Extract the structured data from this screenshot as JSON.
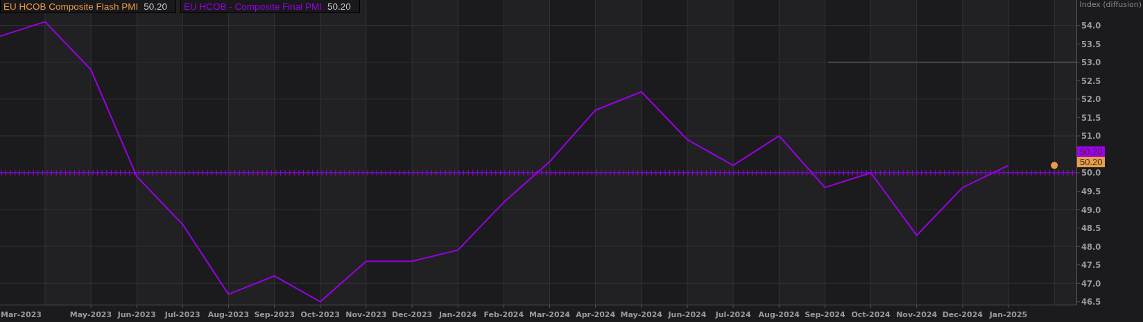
{
  "legend": [
    {
      "value": "50.20"
    },
    {
      "value": "50.20"
    }
  ],
  "chart": {
    "chart_data": {
      "type": "line",
      "ylabel": "Index (diffusion)",
      "categories": [
        null,
        null,
        "May-2023",
        "Jun-2023",
        "Jul-2023",
        "Aug-2023",
        "Sep-2023",
        "Oct-2023",
        "Nov-2023",
        "Dec-2023",
        "Jan-2024",
        "Feb-2024",
        "Mar-2024",
        "Apr-2024",
        "May-2024",
        "Jun-2024",
        "Jul-2024",
        "Aug-2024",
        "Sep-2024",
        "Oct-2024",
        "Nov-2024",
        "Dec-2024",
        "Jan-2025",
        null
      ],
      "ylim": [
        46.42,
        54.69
      ],
      "grid": true,
      "series": [
        {
          "name": "EU HCOB Composite Flash PMI",
          "color": "#e8994a",
          "marker": "circle",
          "values": [
            null,
            null,
            null,
            null,
            null,
            null,
            null,
            null,
            null,
            null,
            null,
            null,
            null,
            null,
            null,
            null,
            null,
            null,
            null,
            null,
            null,
            null,
            null,
            50.2
          ]
        },
        {
          "name": "EU HCOB - Composite Final PMI",
          "color": "#9a00e8",
          "values": [
            53.7,
            54.1,
            52.8,
            49.9,
            48.6,
            46.7,
            47.2,
            46.5,
            47.6,
            47.6,
            47.9,
            49.2,
            50.3,
            51.7,
            52.2,
            50.9,
            50.2,
            51.0,
            49.6,
            50.0,
            48.3,
            49.6,
            50.2,
            null
          ]
        }
      ],
      "yticks": [
        {
          "value": 54,
          "label": "54.0"
        },
        {
          "value": 53.5,
          "label": "53.5"
        },
        {
          "value": 53,
          "label": "53.0"
        },
        {
          "value": 52.5,
          "label": "52.5"
        },
        {
          "value": 52,
          "label": "52.0"
        },
        {
          "value": 51.5,
          "label": "51.5"
        },
        {
          "value": 51,
          "label": "51.0"
        },
        {
          "value": 50,
          "label": "50.0"
        },
        {
          "value": 49.5,
          "label": "49.5"
        },
        {
          "value": 49,
          "label": "49.0"
        },
        {
          "value": 48.5,
          "label": "48.5"
        },
        {
          "value": 48,
          "label": "48.0"
        },
        {
          "value": 47.5,
          "label": "47.5"
        },
        {
          "value": 47,
          "label": "47.0"
        },
        {
          "value": 46.5,
          "label": "46.5"
        }
      ],
      "ref_lines": [
        {
          "axis": "y",
          "value": 50,
          "color": "#9a00e8"
        },
        {
          "axis": "y",
          "value": 53,
          "color": "#4a4a4a"
        }
      ]
    },
    "edge_tick_label": "Mar-2023",
    "price_tags": [
      {
        "text": "50.20",
        "color": "#a000f0"
      },
      {
        "text": "50.20",
        "color": "#e8a04a"
      }
    ]
  }
}
